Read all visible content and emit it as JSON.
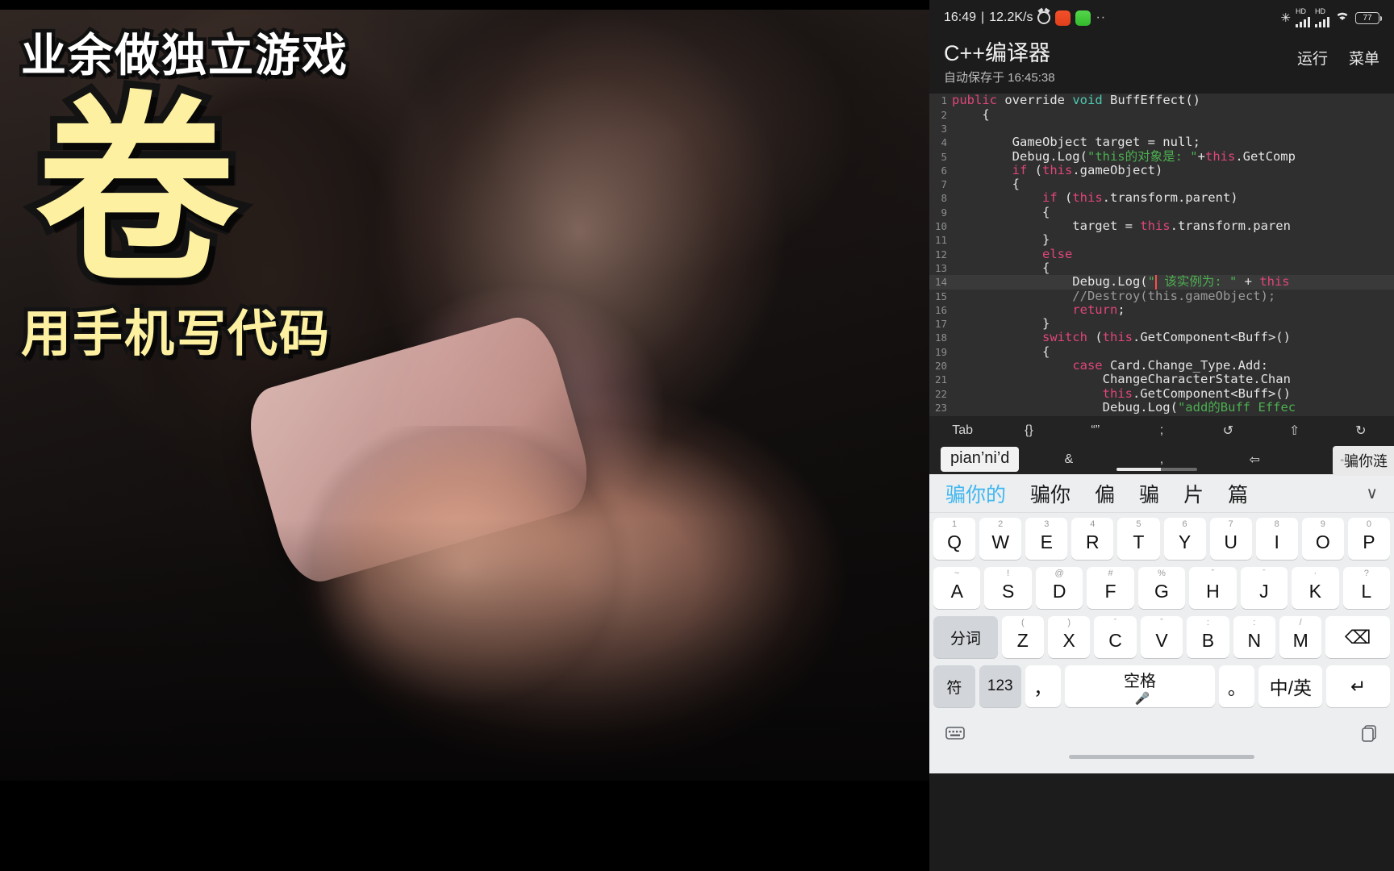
{
  "overlay": {
    "line1": "业余做独立游戏",
    "big": "卷",
    "line3": "用手机写代码"
  },
  "phone": {
    "statusbar": {
      "time": "16:49",
      "separator": "|",
      "netspeed": "12.2K/s",
      "alarm_icon": "alarm-icon",
      "app_icon_red": "recorder-icon",
      "app_icon_green": "download-icon",
      "more_icon": "··",
      "bluetooth_glyph": "✳",
      "hd_label_1": "HD",
      "hd_label_2": "HD",
      "wifi_icon": "wifi-icon",
      "battery_percent": "77"
    },
    "header": {
      "title": "C++编译器",
      "subtitle": "自动保存于 16:45:38",
      "run_label": "运行",
      "menu_label": "菜单"
    },
    "editor": {
      "lines": [
        {
          "n": "1",
          "html": "<span class=\"k\">public</span> <span class=\"ccode\">override</span> <span class=\"t\">void</span> <span class=\"ccode\">BuffEffect()</span>"
        },
        {
          "n": "2",
          "html": "<span class=\"ccode\">    {</span>"
        },
        {
          "n": "3",
          "html": ""
        },
        {
          "n": "4",
          "html": "<span class=\"ccode\">        GameObject target = null;</span>"
        },
        {
          "n": "5",
          "html": "<span class=\"ccode\">        Debug.Log(</span><span class=\"s\">\"this的对象是: \"</span><span class=\"ccode\">+</span><span class=\"k\">this</span><span class=\"ccode\">.GetComp</span>"
        },
        {
          "n": "6",
          "html": "<span class=\"ccode\">        </span><span class=\"k\">if</span><span class=\"ccode\"> (</span><span class=\"k\">this</span><span class=\"ccode\">.gameObject)</span>"
        },
        {
          "n": "7",
          "html": "<span class=\"ccode\">        {</span>"
        },
        {
          "n": "8",
          "html": "<span class=\"ccode\">            </span><span class=\"k\">if</span><span class=\"ccode\"> (</span><span class=\"k\">this</span><span class=\"ccode\">.transform.parent)</span>"
        },
        {
          "n": "9",
          "html": "<span class=\"ccode\">            {</span>"
        },
        {
          "n": "10",
          "html": "<span class=\"ccode\">                target = </span><span class=\"k\">this</span><span class=\"ccode\">.transform.paren</span>"
        },
        {
          "n": "11",
          "html": "<span class=\"ccode\">            }</span>"
        },
        {
          "n": "12",
          "html": "<span class=\"ccode\">            </span><span class=\"k\">else</span>"
        },
        {
          "n": "13",
          "html": "<span class=\"ccode\">            {</span>"
        },
        {
          "n": "14",
          "html": "<span class=\"ccode\">                Debug.Log(</span><span class=\"s\">\"</span><span class=\"caret\">|</span><span class=\"s\"> 该实例为: \"</span><span class=\"ccode\"> + </span><span class=\"k\">this</span>",
          "hl": true
        },
        {
          "n": "15",
          "html": "<span class=\"cm\">                //Destroy(this.gameObject);</span>"
        },
        {
          "n": "16",
          "html": "<span class=\"ccode\">                </span><span class=\"k\">return</span><span class=\"ccode\">;</span>"
        },
        {
          "n": "17",
          "html": "<span class=\"ccode\">            }</span>"
        },
        {
          "n": "18",
          "html": "<span class=\"ccode\">            </span><span class=\"k\">switch</span><span class=\"ccode\"> (</span><span class=\"k\">this</span><span class=\"ccode\">.GetComponent&lt;Buff&gt;()</span>"
        },
        {
          "n": "19",
          "html": "<span class=\"ccode\">            {</span>"
        },
        {
          "n": "20",
          "html": "<span class=\"ccode\">                </span><span class=\"k\">case</span><span class=\"ccode\"> Card.Change_Type.Add:</span>"
        },
        {
          "n": "21",
          "html": "<span class=\"ccode\">                    ChangeCharacterState.Chan</span>"
        },
        {
          "n": "22",
          "html": "<span class=\"ccode\">                    </span><span class=\"k\">this</span><span class=\"ccode\">.GetComponent&lt;Buff&gt;()</span>"
        },
        {
          "n": "23",
          "html": "<span class=\"ccode\">                    Debug.Log(</span><span class=\"s\">\"add的Buff Effec</span>"
        }
      ]
    },
    "toolbar1": {
      "items": [
        "Tab",
        "{}",
        "“”",
        ";",
        "↺",
        "⇧",
        "↻"
      ]
    },
    "toolbar2": {
      "items": [
        "\\",
        "&",
        ",",
        "⇦",
        "⇩"
      ],
      "compose_text": "骗你涟",
      "compose_quote": "“"
    },
    "ime": {
      "pinyin_chip": "pian’ni’d",
      "candidates": [
        "骗你的",
        "骗你",
        "偏",
        "骗",
        "片",
        "篇"
      ],
      "selected_index": 0,
      "expand_icon": "chevron-down-icon",
      "rows": [
        [
          {
            "sup": "1",
            "main": "Q"
          },
          {
            "sup": "2",
            "main": "W"
          },
          {
            "sup": "3",
            "main": "E"
          },
          {
            "sup": "4",
            "main": "R"
          },
          {
            "sup": "5",
            "main": "T"
          },
          {
            "sup": "6",
            "main": "Y"
          },
          {
            "sup": "7",
            "main": "U"
          },
          {
            "sup": "8",
            "main": "I"
          },
          {
            "sup": "9",
            "main": "O"
          },
          {
            "sup": "0",
            "main": "P"
          }
        ],
        [
          {
            "sup": "~",
            "main": "A"
          },
          {
            "sup": "!",
            "main": "S"
          },
          {
            "sup": "@",
            "main": "D"
          },
          {
            "sup": "#",
            "main": "F"
          },
          {
            "sup": "%",
            "main": "G"
          },
          {
            "sup": "ˇ",
            "main": "H"
          },
          {
            "sup": "ˉ",
            "main": "J"
          },
          {
            "sup": "·",
            "main": "K"
          },
          {
            "sup": "?",
            "main": "L"
          }
        ],
        [
          {
            "sup": "",
            "main": "分词",
            "fn": true
          },
          {
            "sup": "(",
            "main": "Z"
          },
          {
            "sup": ")",
            "main": "X"
          },
          {
            "sup": "ˉ",
            "main": "C"
          },
          {
            "sup": "ˇ",
            "main": "V"
          },
          {
            "sup": ":",
            "main": "B"
          },
          {
            "sup": ":",
            "main": "N"
          },
          {
            "sup": "/",
            "main": "M"
          },
          {
            "sup": "",
            "main": "⌫",
            "fn": false
          }
        ],
        [
          {
            "sup": "",
            "main": "符",
            "fn": true
          },
          {
            "sup": "",
            "main": "123",
            "fn": true
          },
          {
            "sup": "",
            "main": "，"
          },
          {
            "sup": "",
            "main": "空格",
            "mic": "🎤"
          },
          {
            "sup": "",
            "main": "。"
          },
          {
            "sup": "",
            "main": "中/英",
            "fn": false
          },
          {
            "sup": "",
            "main": "↵",
            "fn": false
          }
        ]
      ],
      "bottom_left_icon": "keyboard-switch-icon",
      "bottom_right_icon": "clipboard-icon"
    }
  }
}
